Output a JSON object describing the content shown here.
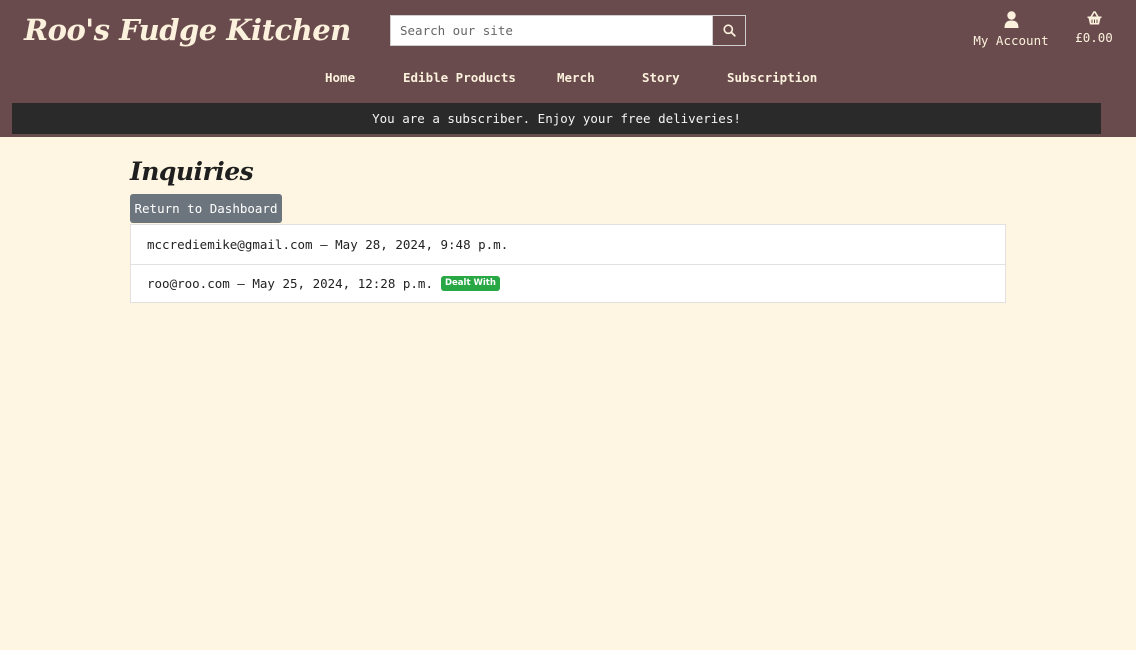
{
  "site": {
    "logo_text": "Roo's Fudge Kitchen"
  },
  "search": {
    "placeholder": "Search our site",
    "value": ""
  },
  "header": {
    "account_label": "My Account",
    "cart_total": "£0.00"
  },
  "nav": {
    "items": [
      {
        "label": "Home"
      },
      {
        "label": "Edible Products"
      },
      {
        "label": "Merch"
      },
      {
        "label": "Story"
      },
      {
        "label": "Subscription"
      }
    ]
  },
  "banner": {
    "message": "You are a subscriber. Enjoy your free deliveries!"
  },
  "page": {
    "title": "Inquiries",
    "return_button": "Return to Dashboard"
  },
  "inquiries": [
    {
      "text": "mccrediemike@gmail.com – May 28, 2024, 9:48 p.m.",
      "badge": ""
    },
    {
      "text": "roo@roo.com – May 25, 2024, 12:28 p.m.",
      "badge": "Dealt With"
    }
  ],
  "colors": {
    "header_bg": "#6a4b4d",
    "page_bg": "#fef6e2",
    "banner_bg": "#2a2a2a",
    "badge_success": "#28a745",
    "button_secondary": "#6c757d"
  },
  "icons": {
    "search": "search-icon",
    "account": "user-icon",
    "cart": "basket-icon"
  }
}
